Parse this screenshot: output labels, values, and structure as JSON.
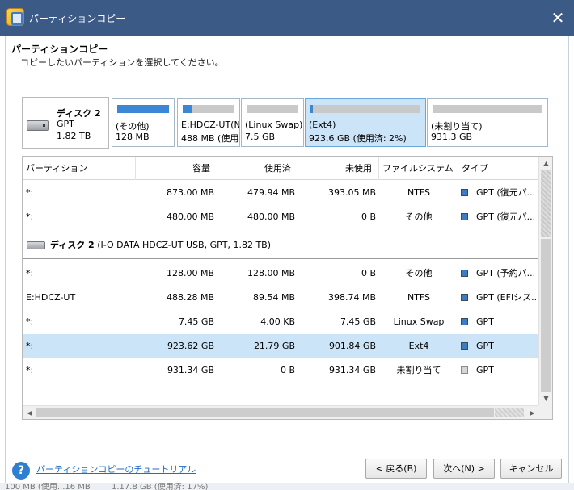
{
  "window": {
    "title": "パーティションコピー",
    "close_glyph": "✕"
  },
  "header": {
    "title": "パーティションコピー",
    "subtitle": "コピーしたいパーティションを選択してください。"
  },
  "disk_strip": {
    "disk": {
      "name": "ディスク 2",
      "type": "GPT",
      "size": "1.82 TB"
    },
    "partitions": [
      {
        "label": "(その他)",
        "size": "128 MB",
        "used_fraction": 1.0,
        "selected": false
      },
      {
        "label": "E:HDCZ-UT(N",
        "size": "488 MB (使用",
        "used_fraction": 0.18,
        "selected": false
      },
      {
        "label": "(Linux Swap)",
        "size": "7.5 GB",
        "used_fraction": 0.0,
        "selected": false
      },
      {
        "label": "(Ext4)",
        "size": "923.6 GB (使用済: 2%)",
        "used_fraction": 0.02,
        "selected": true
      },
      {
        "label": "(未割り当て)",
        "size": "931.3 GB",
        "used_fraction": 0.0,
        "selected": false
      }
    ]
  },
  "table": {
    "columns": [
      "パーティション",
      "容量",
      "使用済",
      "未使用",
      "ファイルシステム",
      "タイプ"
    ],
    "rows_top": [
      {
        "partition": "*:",
        "capacity": "873.00 MB",
        "used": "479.94 MB",
        "unused": "393.05 MB",
        "fs": "NTFS",
        "type": "GPT (復元パ...",
        "unalloc": false,
        "selected": false
      },
      {
        "partition": "*:",
        "capacity": "480.00 MB",
        "used": "480.00 MB",
        "unused": "0 B",
        "fs": "その他",
        "type": "GPT (復元パ...",
        "unalloc": false,
        "selected": false
      }
    ],
    "disk_row": {
      "name": "ディスク 2",
      "detail": "(I-O DATA HDCZ-UT USB, GPT, 1.82 TB)"
    },
    "rows_disk2": [
      {
        "partition": "*:",
        "capacity": "128.00 MB",
        "used": "128.00 MB",
        "unused": "0 B",
        "fs": "その他",
        "type": "GPT (予約パ...",
        "unalloc": false,
        "selected": false
      },
      {
        "partition": "E:HDCZ-UT",
        "capacity": "488.28 MB",
        "used": "89.54 MB",
        "unused": "398.74 MB",
        "fs": "NTFS",
        "type": "GPT (EFIシス...",
        "unalloc": false,
        "selected": false
      },
      {
        "partition": "*:",
        "capacity": "7.45 GB",
        "used": "4.00 KB",
        "unused": "7.45 GB",
        "fs": "Linux Swap",
        "type": "GPT",
        "unalloc": false,
        "selected": false
      },
      {
        "partition": "*:",
        "capacity": "923.62 GB",
        "used": "21.79 GB",
        "unused": "901.84 GB",
        "fs": "Ext4",
        "type": "GPT",
        "unalloc": false,
        "selected": true
      },
      {
        "partition": "*:",
        "capacity": "931.34 GB",
        "used": "0 B",
        "unused": "931.34 GB",
        "fs": "未割り当て",
        "type": "GPT",
        "unalloc": true,
        "selected": false
      }
    ]
  },
  "footer": {
    "help_glyph": "?",
    "tutorial_link": "パーティションコピーのチュートリアル",
    "back_label": "< 戻る(B)",
    "next_label": "次へ(N) >",
    "cancel_label": "キャンセル"
  },
  "background_text": {
    "left": "100 MB (使用...16 MB",
    "right": "1.17.8 GB (使用済: 17%)"
  },
  "colors": {
    "titlebar": "#3c5a86",
    "accent": "#3b87d4",
    "selection": "#cce4f7",
    "link": "#1f6dc4"
  }
}
